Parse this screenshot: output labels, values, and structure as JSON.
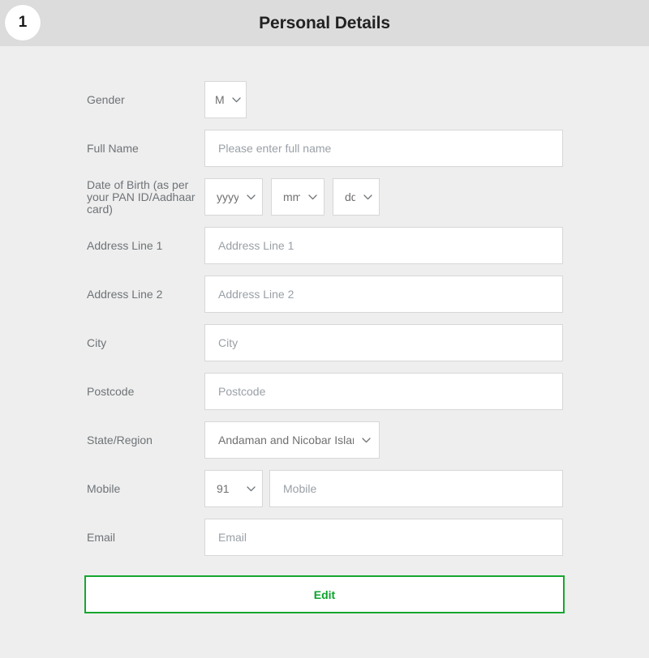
{
  "header": {
    "step_number": "1",
    "title": "Personal Details"
  },
  "form": {
    "fields": [
      {
        "label": "Gender",
        "type": "select",
        "value": "M"
      },
      {
        "label": "Full Name",
        "type": "text",
        "placeholder": "Please enter full name",
        "value": ""
      },
      {
        "label": "Date of Birth (as per your PAN ID/Aadhaar card)",
        "type": "date-group",
        "year": "yyyy",
        "month": "mm",
        "day": "dd"
      },
      {
        "label": "Address Line 1",
        "type": "text",
        "placeholder": "Address Line 1",
        "value": ""
      },
      {
        "label": "Address Line 2",
        "type": "text",
        "placeholder": "Address Line 2",
        "value": ""
      },
      {
        "label": "City",
        "type": "text",
        "placeholder": "City",
        "value": ""
      },
      {
        "label": "Postcode",
        "type": "text",
        "placeholder": "Postcode",
        "value": ""
      },
      {
        "label": "State/Region",
        "type": "select",
        "value": "Andaman and Nicobar Islands"
      },
      {
        "label": "Mobile",
        "type": "phone",
        "country_code": "91",
        "placeholder": "Mobile",
        "value": ""
      },
      {
        "label": "Email",
        "type": "text",
        "placeholder": "Email",
        "value": ""
      }
    ]
  },
  "actions": {
    "edit_label": "Edit"
  },
  "icons": {
    "chevron_down": "chevron-down-icon"
  },
  "colors": {
    "page_background": "#eeeeee",
    "header_background": "#dcdcdc",
    "field_background": "#ffffff",
    "field_border": "#d7d7d7",
    "label_text": "#6e7377",
    "placeholder_text": "#9aa0a6",
    "accent_green": "#0aa32b"
  }
}
